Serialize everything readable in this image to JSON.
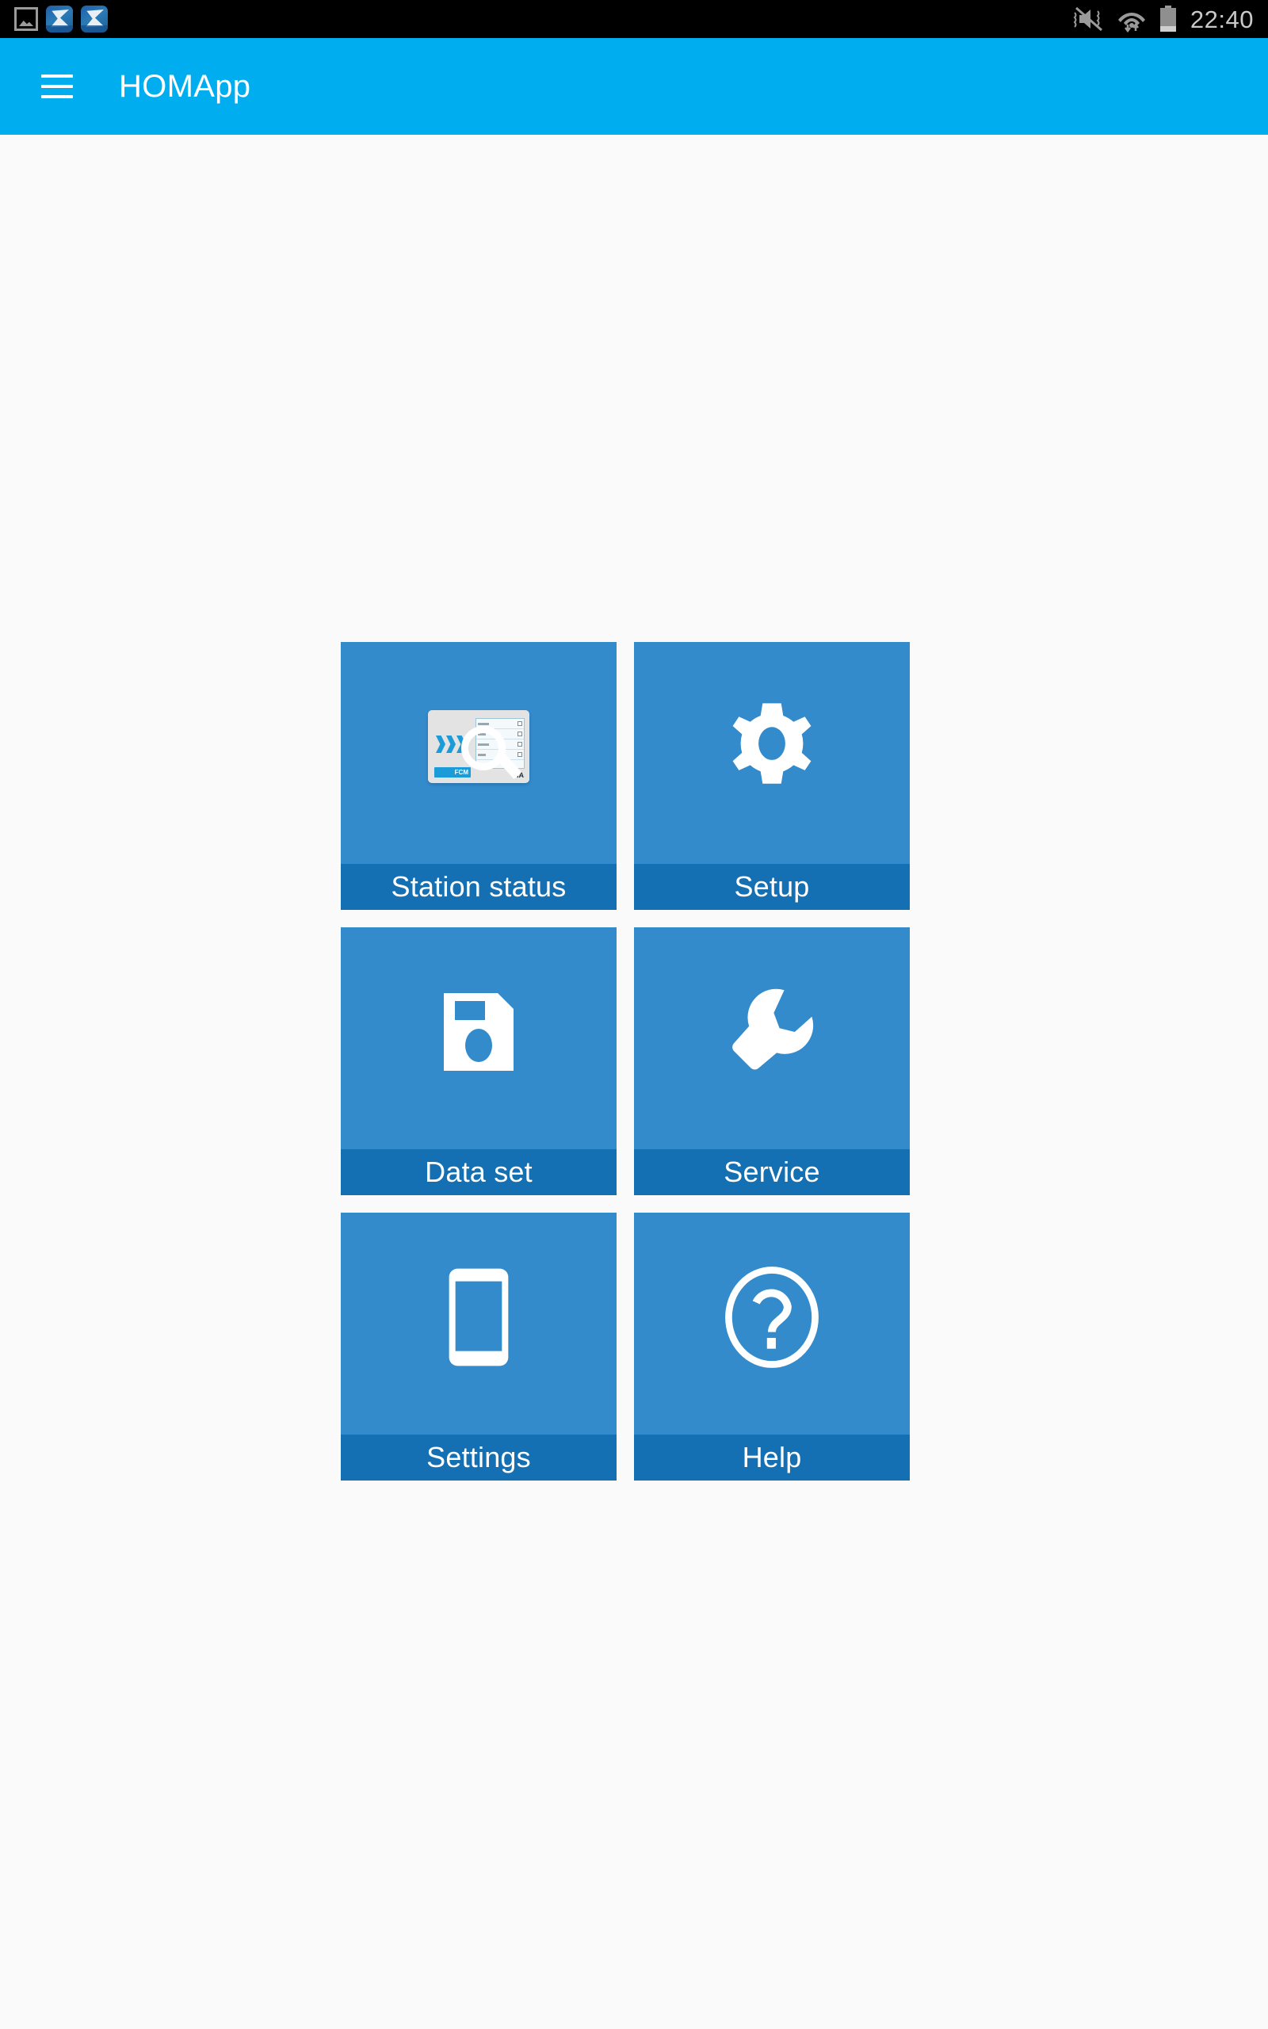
{
  "status_bar": {
    "time": "22:40",
    "left_icons": [
      {
        "name": "screenshot-notification-icon",
        "glyph": "image"
      },
      {
        "name": "app-notification-icon-1",
        "glyph": "app"
      },
      {
        "name": "app-notification-icon-2",
        "glyph": "app"
      }
    ],
    "right_icons": [
      {
        "name": "sound-muted-icon",
        "glyph": "speaker-mute"
      },
      {
        "name": "wifi-icon",
        "glyph": "wifi-data-transfer"
      },
      {
        "name": "battery-icon",
        "glyph": "battery-high"
      }
    ]
  },
  "app_bar": {
    "title": "HOMApp",
    "menu_label": "menu",
    "background_color": "#00aeef",
    "text_color": "#ffffff"
  },
  "theme": {
    "page_background": "#fafafa",
    "tile_background": "#338bcc",
    "tile_label_background": "#1470b2",
    "tile_text": "#ffffff",
    "accent": "#00aeef"
  },
  "home_grid": {
    "columns": 2,
    "tiles": [
      {
        "id": "station-status",
        "label": "Station status",
        "icon": "station-status-icon"
      },
      {
        "id": "setup",
        "label": "Setup",
        "icon": "gear-icon"
      },
      {
        "id": "data-set",
        "label": "Data set",
        "icon": "floppy-disk-save-icon"
      },
      {
        "id": "service",
        "label": "Service",
        "icon": "wrench-icon"
      },
      {
        "id": "settings",
        "label": "Settings",
        "icon": "smartphone-icon"
      },
      {
        "id": "help",
        "label": "Help",
        "icon": "question-mark-circle-icon"
      }
    ]
  },
  "station_icon_detail": {
    "badge_text": "FCM",
    "brand_text": "HA"
  }
}
